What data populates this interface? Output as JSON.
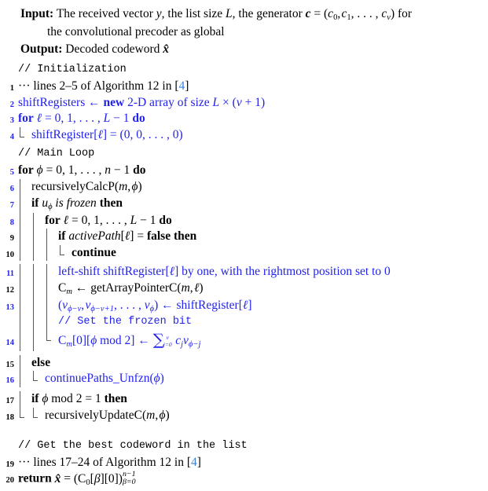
{
  "algorithm": {
    "colors": {
      "accent_blue": "#2222ee",
      "cite_blue": "#3b7fd4",
      "guide_gray": "#555555",
      "text_black": "#000000"
    },
    "header": {
      "input_label": "Input:",
      "input_text_1": "The received vector ",
      "input_var_y": "y",
      "input_text_2": ", the list size ",
      "input_var_L": "L",
      "input_text_3": ", the generator ",
      "input_var_c": "c",
      "input_eq": " = (",
      "input_c0": "c",
      "input_c0_sub": "0",
      "input_c1": "c",
      "input_c1_sub": "1",
      "input_dots": ", . . . , ",
      "input_cv": "c",
      "input_cv_sub": "ν",
      "input_tail": ") for",
      "input_line2": "the convolutional precoder as global",
      "output_label": "Output:",
      "output_text": "Decoded codeword ",
      "output_var": "x̂"
    },
    "comments": {
      "init": "// Initialization",
      "main_loop": "// Main Loop",
      "frozen_bit": "// Set the frozen bit",
      "best_codeword": "// Get the best codeword in the list"
    },
    "lines": [
      {
        "number": "1",
        "number_color": "black",
        "color": "black",
        "text": "··· lines 2–5 of Algorithm 12 in [4]"
      },
      {
        "number": "2",
        "number_color": "blue",
        "color": "blue",
        "text": "shiftRegisters ← new 2-D array of size L × (ν + 1)"
      },
      {
        "number": "3",
        "number_color": "blue",
        "color": "blue",
        "text": "for ℓ = 0, 1, . . . , L − 1 do"
      },
      {
        "number": "4",
        "number_color": "blue",
        "color": "blue",
        "text": "shiftRegister[ℓ] = (0, 0, . . . , 0)"
      },
      {
        "number": "5",
        "number_color": "blue",
        "color": "black",
        "text": "for ϕ = 0, 1, . . . , n − 1 do"
      },
      {
        "number": "6",
        "number_color": "blue",
        "color": "black",
        "text": "recursivelyCalcP(m, ϕ)"
      },
      {
        "number": "7",
        "number_color": "blue",
        "color": "black",
        "text": "if uϕ is frozen then"
      },
      {
        "number": "8",
        "number_color": "blue",
        "color": "black",
        "text": "for ℓ = 0, 1, . . . , L − 1 do"
      },
      {
        "number": "9",
        "number_color": "black",
        "color": "black",
        "text": "if activePath[ℓ] = false then"
      },
      {
        "number": "10",
        "number_color": "black",
        "color": "black",
        "text": "continue"
      },
      {
        "number": "11",
        "number_color": "blue",
        "color": "blue",
        "text": "left-shift shiftRegister[ℓ] by one, with the rightmost position set to 0"
      },
      {
        "number": "12",
        "number_color": "black",
        "color": "black",
        "text": "Cₘ ← getArrayPointerC(m, ℓ)"
      },
      {
        "number": "13",
        "number_color": "blue",
        "color": "blue",
        "text": "(vϕ−ν, vϕ−ν+1, . . . , vϕ) ← shiftRegister[ℓ]"
      },
      {
        "number": "14",
        "number_color": "blue",
        "color": "blue",
        "text": "Cₘ[0][ϕ mod 2] ← Σⱼ₌₀ᵛ cⱼ vϕ₋ⱼ"
      },
      {
        "number": "15",
        "number_color": "black",
        "color": "black",
        "text": "else"
      },
      {
        "number": "16",
        "number_color": "blue",
        "color": "blue",
        "text": "continuePaths_Unfzn(ϕ)"
      },
      {
        "number": "17",
        "number_color": "black",
        "color": "black",
        "text": "if ϕ mod 2 = 1 then"
      },
      {
        "number": "18",
        "number_color": "black",
        "color": "black",
        "text": "recursivelyUpdateC(m, ϕ)"
      },
      {
        "number": "19",
        "number_color": "black",
        "color": "black",
        "text": "··· lines 17–24 of Algorithm 12 in [4]"
      },
      {
        "number": "20",
        "number_color": "black",
        "color": "black",
        "text": "return x̂ = (C₀[β][0])ᵝ₌₀ⁿ⁻¹"
      }
    ],
    "tokens": {
      "kw_new": "new",
      "kw_for": "for",
      "kw_do": "do",
      "kw_if": "if",
      "kw_then": "then",
      "kw_else": "else",
      "kw_continue": "continue",
      "kw_return": "return",
      "kw_false": "false",
      "kw_is_frozen": "is frozen",
      "kw_mod": "mod",
      "fn_recursivelyCalcP": "recursivelyCalcP",
      "fn_getArrayPointerC": "getArrayPointerC",
      "fn_continuePaths": "continuePaths_Unfzn",
      "fn_recursivelyUpdateC": "recursivelyUpdateC",
      "id_shiftRegisters": "shiftRegisters",
      "id_shiftRegister": "shiftRegister",
      "id_activePath": "activePath",
      "citation": "4",
      "l1_dots": "···",
      "l1_a": "lines 2–5 of Algorithm 12 in [",
      "l1_b": "]",
      "l19_a": "lines 17–24 of Algorithm 12 in [",
      "l19_b": "]",
      "arrow": "←",
      "times": "×",
      "minus": "−",
      "eq": "=",
      "dots": ", . . . , ",
      "two_d_array": "2-D array of size",
      "left_shift_text": "left-shift",
      "left_shift_tail": "by one, with the rightmost position set to 0",
      "zeros": "(0, 0, . . . , 0)",
      "sum_sigma": "∑"
    }
  }
}
